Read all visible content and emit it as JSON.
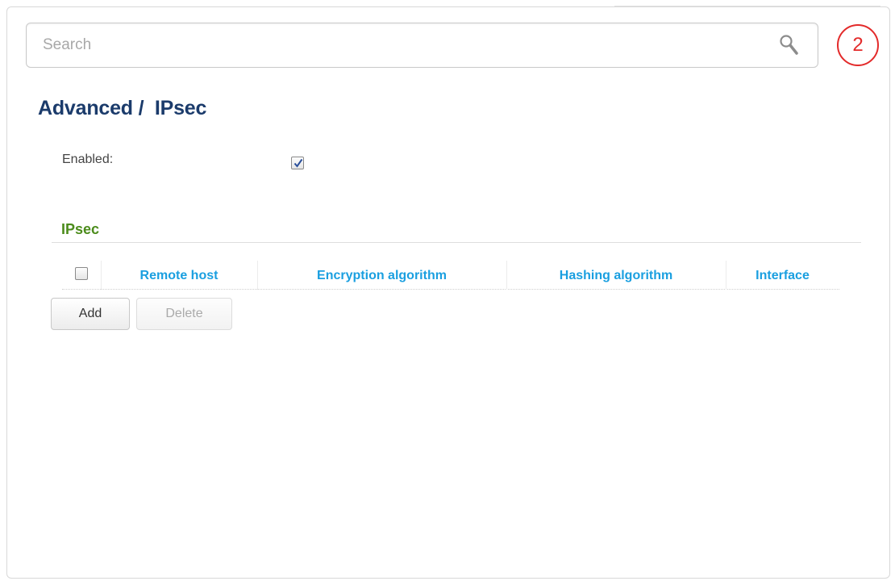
{
  "search": {
    "placeholder": "Search",
    "icon": "search-icon"
  },
  "callout": {
    "number": "2"
  },
  "page": {
    "title": "Advanced /  IPsec"
  },
  "settings": {
    "enabled_label": "Enabled:",
    "enabled_checked": true
  },
  "section": {
    "title": "IPsec"
  },
  "table": {
    "columns": [
      "Remote host",
      "Encryption algorithm",
      "Hashing algorithm",
      "Interface"
    ],
    "rows": []
  },
  "buttons": {
    "add": "Add",
    "delete": "Delete"
  },
  "colors": {
    "title": "#1b3b6b",
    "section_title": "#4c8c1c",
    "column_header": "#1a9fe0",
    "callout": "#e32a2a"
  }
}
